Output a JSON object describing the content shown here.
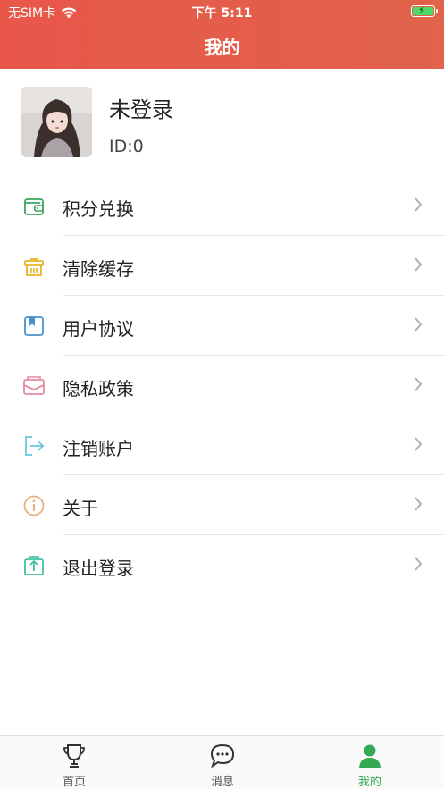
{
  "status_bar": {
    "carrier": "无SIM卡",
    "time": "下午 5:11"
  },
  "header": {
    "title": "我的"
  },
  "profile": {
    "username": "未登录",
    "id_text": "ID:0"
  },
  "menu": [
    {
      "label": "积分兑换",
      "icon": "wallet-icon",
      "color": "#3aa55c"
    },
    {
      "label": "清除缓存",
      "icon": "trash-icon",
      "color": "#e8b424"
    },
    {
      "label": "用户协议",
      "icon": "bookmark-book-icon",
      "color": "#4a90c8"
    },
    {
      "label": "隐私政策",
      "icon": "mail-icon",
      "color": "#e88aa0"
    },
    {
      "label": "注销账户",
      "icon": "logout-arrow-icon",
      "color": "#6cc4e0"
    },
    {
      "label": "关于",
      "icon": "info-icon",
      "color": "#e8b07a"
    },
    {
      "label": "退出登录",
      "icon": "exit-box-icon",
      "color": "#40c0a0"
    }
  ],
  "tabs": [
    {
      "label": "首页",
      "icon": "trophy-icon",
      "active": false
    },
    {
      "label": "消息",
      "icon": "chat-bubble-icon",
      "active": false
    },
    {
      "label": "我的",
      "icon": "person-icon",
      "active": true
    }
  ],
  "colors": {
    "header_bg": "#e55b4a",
    "active_tab": "#34a853"
  }
}
